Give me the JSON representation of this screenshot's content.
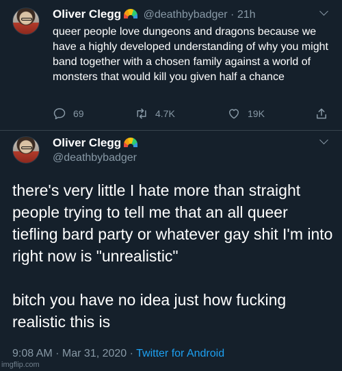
{
  "tweet1": {
    "name": "Oliver Clegg",
    "handle": "@deathbybadger",
    "separator": "·",
    "time": "21h",
    "text": "queer people love dungeons and dragons because we have a highly developed understanding of why you might band together with a chosen family against a world of monsters that would kill you given half a chance",
    "replies": "69",
    "retweets": "4.7K",
    "likes": "19K"
  },
  "tweet2": {
    "name": "Oliver Clegg",
    "handle": "@deathbybadger",
    "paragraph1": "there's very little I hate more than straight people trying to tell me that an all queer tiefling bard party or whatever gay shit I'm into right now is \"unrealistic\"",
    "paragraph2": "bitch you have no idea just how fucking realistic this is",
    "time": "9:08 AM",
    "date": "Mar 31, 2020",
    "source": "Twitter for Android",
    "meta_sep": " · "
  },
  "watermark": "imgflip.com",
  "icons": [
    "avatar",
    "rainbow-icon",
    "chevron-down-icon",
    "reply-icon",
    "retweet-icon",
    "like-icon",
    "share-icon"
  ]
}
